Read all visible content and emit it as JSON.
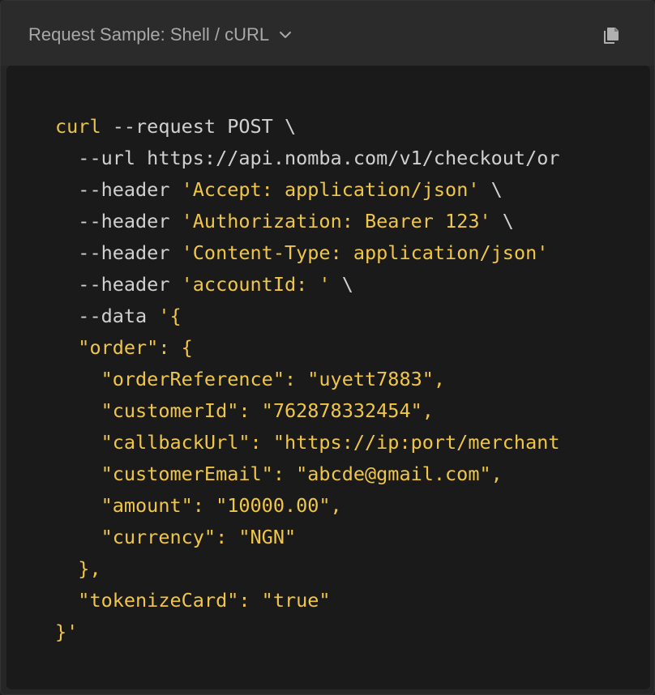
{
  "header": {
    "title": "Request Sample: Shell / cURL",
    "dropdown_icon": "chevron-down-icon",
    "copy_icon": "copy-icon"
  },
  "colors": {
    "panel_bg": "#262626",
    "code_bg": "#1a1a1a",
    "keyword": "#e6c44d",
    "string": "#f0c649",
    "plain": "#d0d0d0",
    "header_text": "#a8a8a8"
  },
  "code": {
    "lines": [
      [
        {
          "t": "kw",
          "s": "curl"
        },
        {
          "t": "plain",
          "s": " --request POST \\"
        }
      ],
      [
        {
          "t": "plain",
          "s": "  --url https://api.nomba.com/v1/checkout/or"
        }
      ],
      [
        {
          "t": "plain",
          "s": "  --header "
        },
        {
          "t": "str",
          "s": "'Accept: application/json'"
        },
        {
          "t": "plain",
          "s": " \\"
        }
      ],
      [
        {
          "t": "plain",
          "s": "  --header "
        },
        {
          "t": "str",
          "s": "'Authorization: Bearer 123'"
        },
        {
          "t": "plain",
          "s": " \\"
        }
      ],
      [
        {
          "t": "plain",
          "s": "  --header "
        },
        {
          "t": "str",
          "s": "'Content-Type: application/json'"
        }
      ],
      [
        {
          "t": "plain",
          "s": "  --header "
        },
        {
          "t": "str",
          "s": "'accountId: '"
        },
        {
          "t": "plain",
          "s": " \\"
        }
      ],
      [
        {
          "t": "plain",
          "s": "  --data "
        },
        {
          "t": "str",
          "s": "'{"
        }
      ],
      [
        {
          "t": "str",
          "s": "  \"order\": {"
        }
      ],
      [
        {
          "t": "str",
          "s": "    \"orderReference\": \"uyett7883\","
        }
      ],
      [
        {
          "t": "str",
          "s": "    \"customerId\": \"762878332454\","
        }
      ],
      [
        {
          "t": "str",
          "s": "    \"callbackUrl\": \"https://ip:port/merchant"
        }
      ],
      [
        {
          "t": "str",
          "s": "    \"customerEmail\": \"abcde@gmail.com\","
        }
      ],
      [
        {
          "t": "str",
          "s": "    \"amount\": \"10000.00\","
        }
      ],
      [
        {
          "t": "str",
          "s": "    \"currency\": \"NGN\""
        }
      ],
      [
        {
          "t": "str",
          "s": "  },"
        }
      ],
      [
        {
          "t": "str",
          "s": "  \"tokenizeCard\": \"true\""
        }
      ],
      [
        {
          "t": "str",
          "s": "}'"
        }
      ]
    ]
  }
}
